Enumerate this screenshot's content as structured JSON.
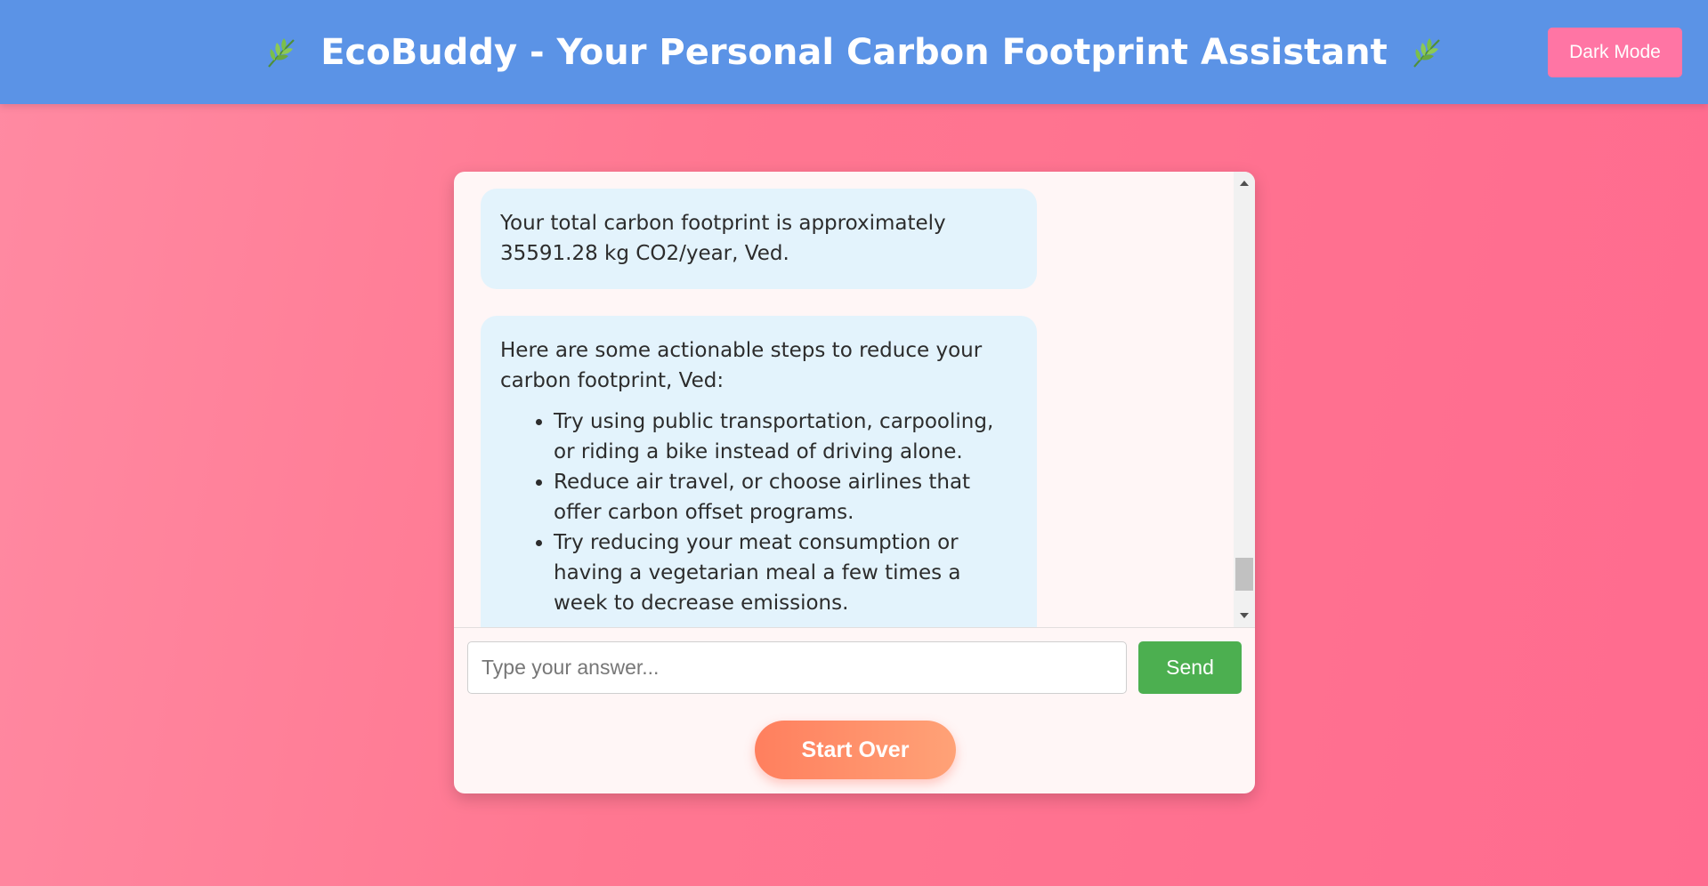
{
  "header": {
    "title": "EcoBuddy - Your Personal Carbon Footprint Assistant",
    "left_icon": "leaf-icon",
    "right_icon": "leaf-icon",
    "dark_mode_label": "Dark Mode"
  },
  "chat": {
    "messages": [
      {
        "sender": "bot",
        "text": "Your total carbon footprint is approximately 35591.28 kg CO2/year, Ved."
      },
      {
        "sender": "bot",
        "text": "Here are some actionable steps to reduce your carbon footprint, Ved:",
        "tips": [
          "Try using public transportation, carpooling, or riding a bike instead of driving alone.",
          "Reduce air travel, or choose airlines that offer carbon offset programs.",
          "Try reducing your meat consumption or having a vegetarian meal a few times a week to decrease emissions."
        ]
      }
    ],
    "input_placeholder": "Type your answer...",
    "input_value": "",
    "send_label": "Send",
    "start_over_label": "Start Over"
  },
  "colors": {
    "header_bg": "#5b93e6",
    "dark_mode_button": "#ff75a4",
    "send_button": "#4caf50",
    "bubble_bg": "#e3f3fc",
    "start_over_gradient": [
      "#ff7f5e",
      "#ffa277"
    ],
    "page_gradient": [
      "#ff8aa2",
      "#ff6b8f"
    ]
  }
}
